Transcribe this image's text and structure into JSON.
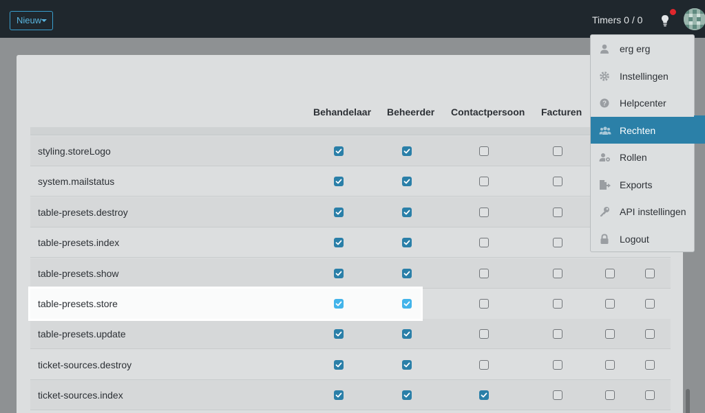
{
  "topbar": {
    "new_label": "Nieuw",
    "timers": "Timers 0 / 0",
    "icons": [
      "lightbulb-icon",
      "notification-dot",
      "avatar"
    ]
  },
  "columns": [
    "Behandelaar",
    "Beheerder",
    "Contactpersoon",
    "Facturen"
  ],
  "rows": [
    {
      "label": "styling.storeLogo",
      "checks": [
        true,
        true,
        false,
        false,
        false,
        false
      ]
    },
    {
      "label": "system.mailstatus",
      "checks": [
        true,
        true,
        false,
        false,
        false,
        false
      ]
    },
    {
      "label": "table-presets.destroy",
      "checks": [
        true,
        true,
        false,
        false,
        false,
        false
      ]
    },
    {
      "label": "table-presets.index",
      "checks": [
        true,
        true,
        false,
        false,
        false,
        false
      ]
    },
    {
      "label": "table-presets.show",
      "checks": [
        true,
        true,
        false,
        false,
        false,
        false
      ]
    },
    {
      "label": "table-presets.store",
      "checks": [
        true,
        true,
        false,
        false,
        false,
        false
      ],
      "highlighted": true
    },
    {
      "label": "table-presets.update",
      "checks": [
        true,
        true,
        false,
        false,
        false,
        false
      ]
    },
    {
      "label": "ticket-sources.destroy",
      "checks": [
        true,
        true,
        false,
        false,
        false,
        false
      ]
    },
    {
      "label": "ticket-sources.index",
      "checks": [
        true,
        true,
        true,
        false,
        false,
        false
      ]
    }
  ],
  "menu": {
    "items": [
      {
        "label": "erg erg",
        "icon": "user-icon",
        "active": false
      },
      {
        "label": "Instellingen",
        "icon": "gear-icon",
        "active": false
      },
      {
        "label": "Helpcenter",
        "icon": "question-circle-icon",
        "active": false
      },
      {
        "label": "Rechten",
        "icon": "users-icon",
        "active": true
      },
      {
        "label": "Rollen",
        "icon": "user-cog-icon",
        "active": false
      },
      {
        "label": "Exports",
        "icon": "file-export-icon",
        "active": false
      },
      {
        "label": "API instellingen",
        "icon": "key-icon",
        "active": false
      },
      {
        "label": "Logout",
        "icon": "lock-icon",
        "active": false
      }
    ]
  },
  "colors": {
    "topbar": "#1f272d",
    "accent": "#2b80a8",
    "checkbox_checked": "#2a7fa8",
    "checkbox_highlight": "#42b4ea",
    "notification": "#e0272d"
  }
}
